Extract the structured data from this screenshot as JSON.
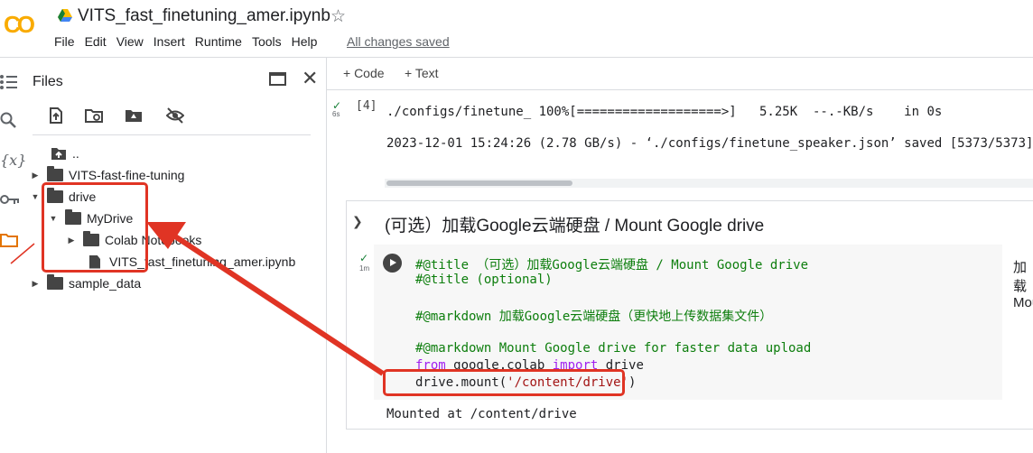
{
  "app": {
    "logo": "CO",
    "notebook_title": "VITS_fast_finetuning_amer.ipynb",
    "menu": [
      "File",
      "Edit",
      "View",
      "Insert",
      "Runtime",
      "Tools",
      "Help"
    ],
    "save_status": "All changes saved"
  },
  "files_panel": {
    "title": "Files",
    "tree": [
      {
        "label": "..",
        "type": "parent"
      },
      {
        "label": "VITS-fast-fine-tuning",
        "type": "folder",
        "state": "collapsed"
      },
      {
        "label": "drive",
        "type": "folder",
        "state": "expanded"
      },
      {
        "label": "MyDrive",
        "type": "folder",
        "state": "expanded"
      },
      {
        "label": "Colab Notebooks",
        "type": "folder",
        "state": "collapsed"
      },
      {
        "label": "VITS_fast_finetuning_amer.ipynb",
        "type": "file"
      },
      {
        "label": "sample_data",
        "type": "folder",
        "state": "collapsed"
      }
    ]
  },
  "toolbar": {
    "code_label": "+ Code",
    "text_label": "+ Text"
  },
  "cell4": {
    "exec_count": "[4]",
    "runtime": "6s",
    "output_line1": "./configs/finetune_ 100%[===================>]   5.25K  --.-KB/s    in 0s",
    "output_line2": "2023-12-01 15:24:26 (2.78 GB/s) - ‘./configs/finetune_speaker.json’ saved [5373/5373]"
  },
  "section": {
    "title": "(可选）加载Google云端硬盘 / Mount Google drive",
    "runtime": "1m",
    "code": {
      "line1": "#@title （可选）加载Google云端硬盘 / Mount Google drive",
      "line2": "#@title (optional)",
      "line3": "#@markdown 加载Google云端硬盘（更快地上传数据集文件）",
      "line4": "#@markdown Mount Google drive for faster data upload",
      "line5_kw1": "from",
      "line5_mod": " google.colab ",
      "line5_kw2": "import",
      "line5_name": " drive",
      "line6_call": "drive.mount(",
      "line6_str": "'/content/drive'",
      "line6_end": ")"
    },
    "output": "Mounted at /content/drive",
    "form_preview_1": "加载",
    "form_preview_2": "Mou"
  },
  "colors": {
    "annotation": "#e03424",
    "success": "#188038",
    "comment": "#0d7e0d",
    "keyword": "#a020f0",
    "string": "#a31515"
  }
}
